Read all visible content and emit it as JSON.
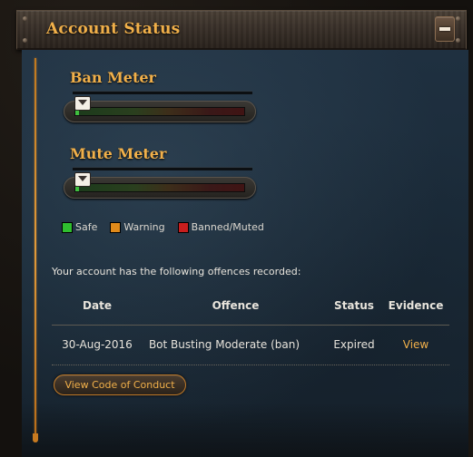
{
  "header": {
    "title": "Account Status",
    "collapse_icon": "minus-icon"
  },
  "meters": {
    "ban": {
      "title": "Ban Meter",
      "level": 0.0
    },
    "mute": {
      "title": "Mute Meter",
      "level": 0.0
    }
  },
  "legend": [
    {
      "label": "Safe",
      "color": "#2fbf2f"
    },
    {
      "label": "Warning",
      "color": "#e08a1a"
    },
    {
      "label": "Banned/Muted",
      "color": "#c81e1e"
    }
  ],
  "offences": {
    "intro": "Your account has the following offences recorded:",
    "columns": [
      "Date",
      "Offence",
      "Status",
      "Evidence"
    ],
    "rows": [
      {
        "date": "30-Aug-2016",
        "offence": "Bot Busting Moderate (ban)",
        "status": "Expired",
        "evidence": "View"
      }
    ]
  },
  "buttons": {
    "conduct_label": "View Code of Conduct"
  },
  "colors": {
    "accent": "#f1b04a",
    "panel": "#1f3040"
  }
}
